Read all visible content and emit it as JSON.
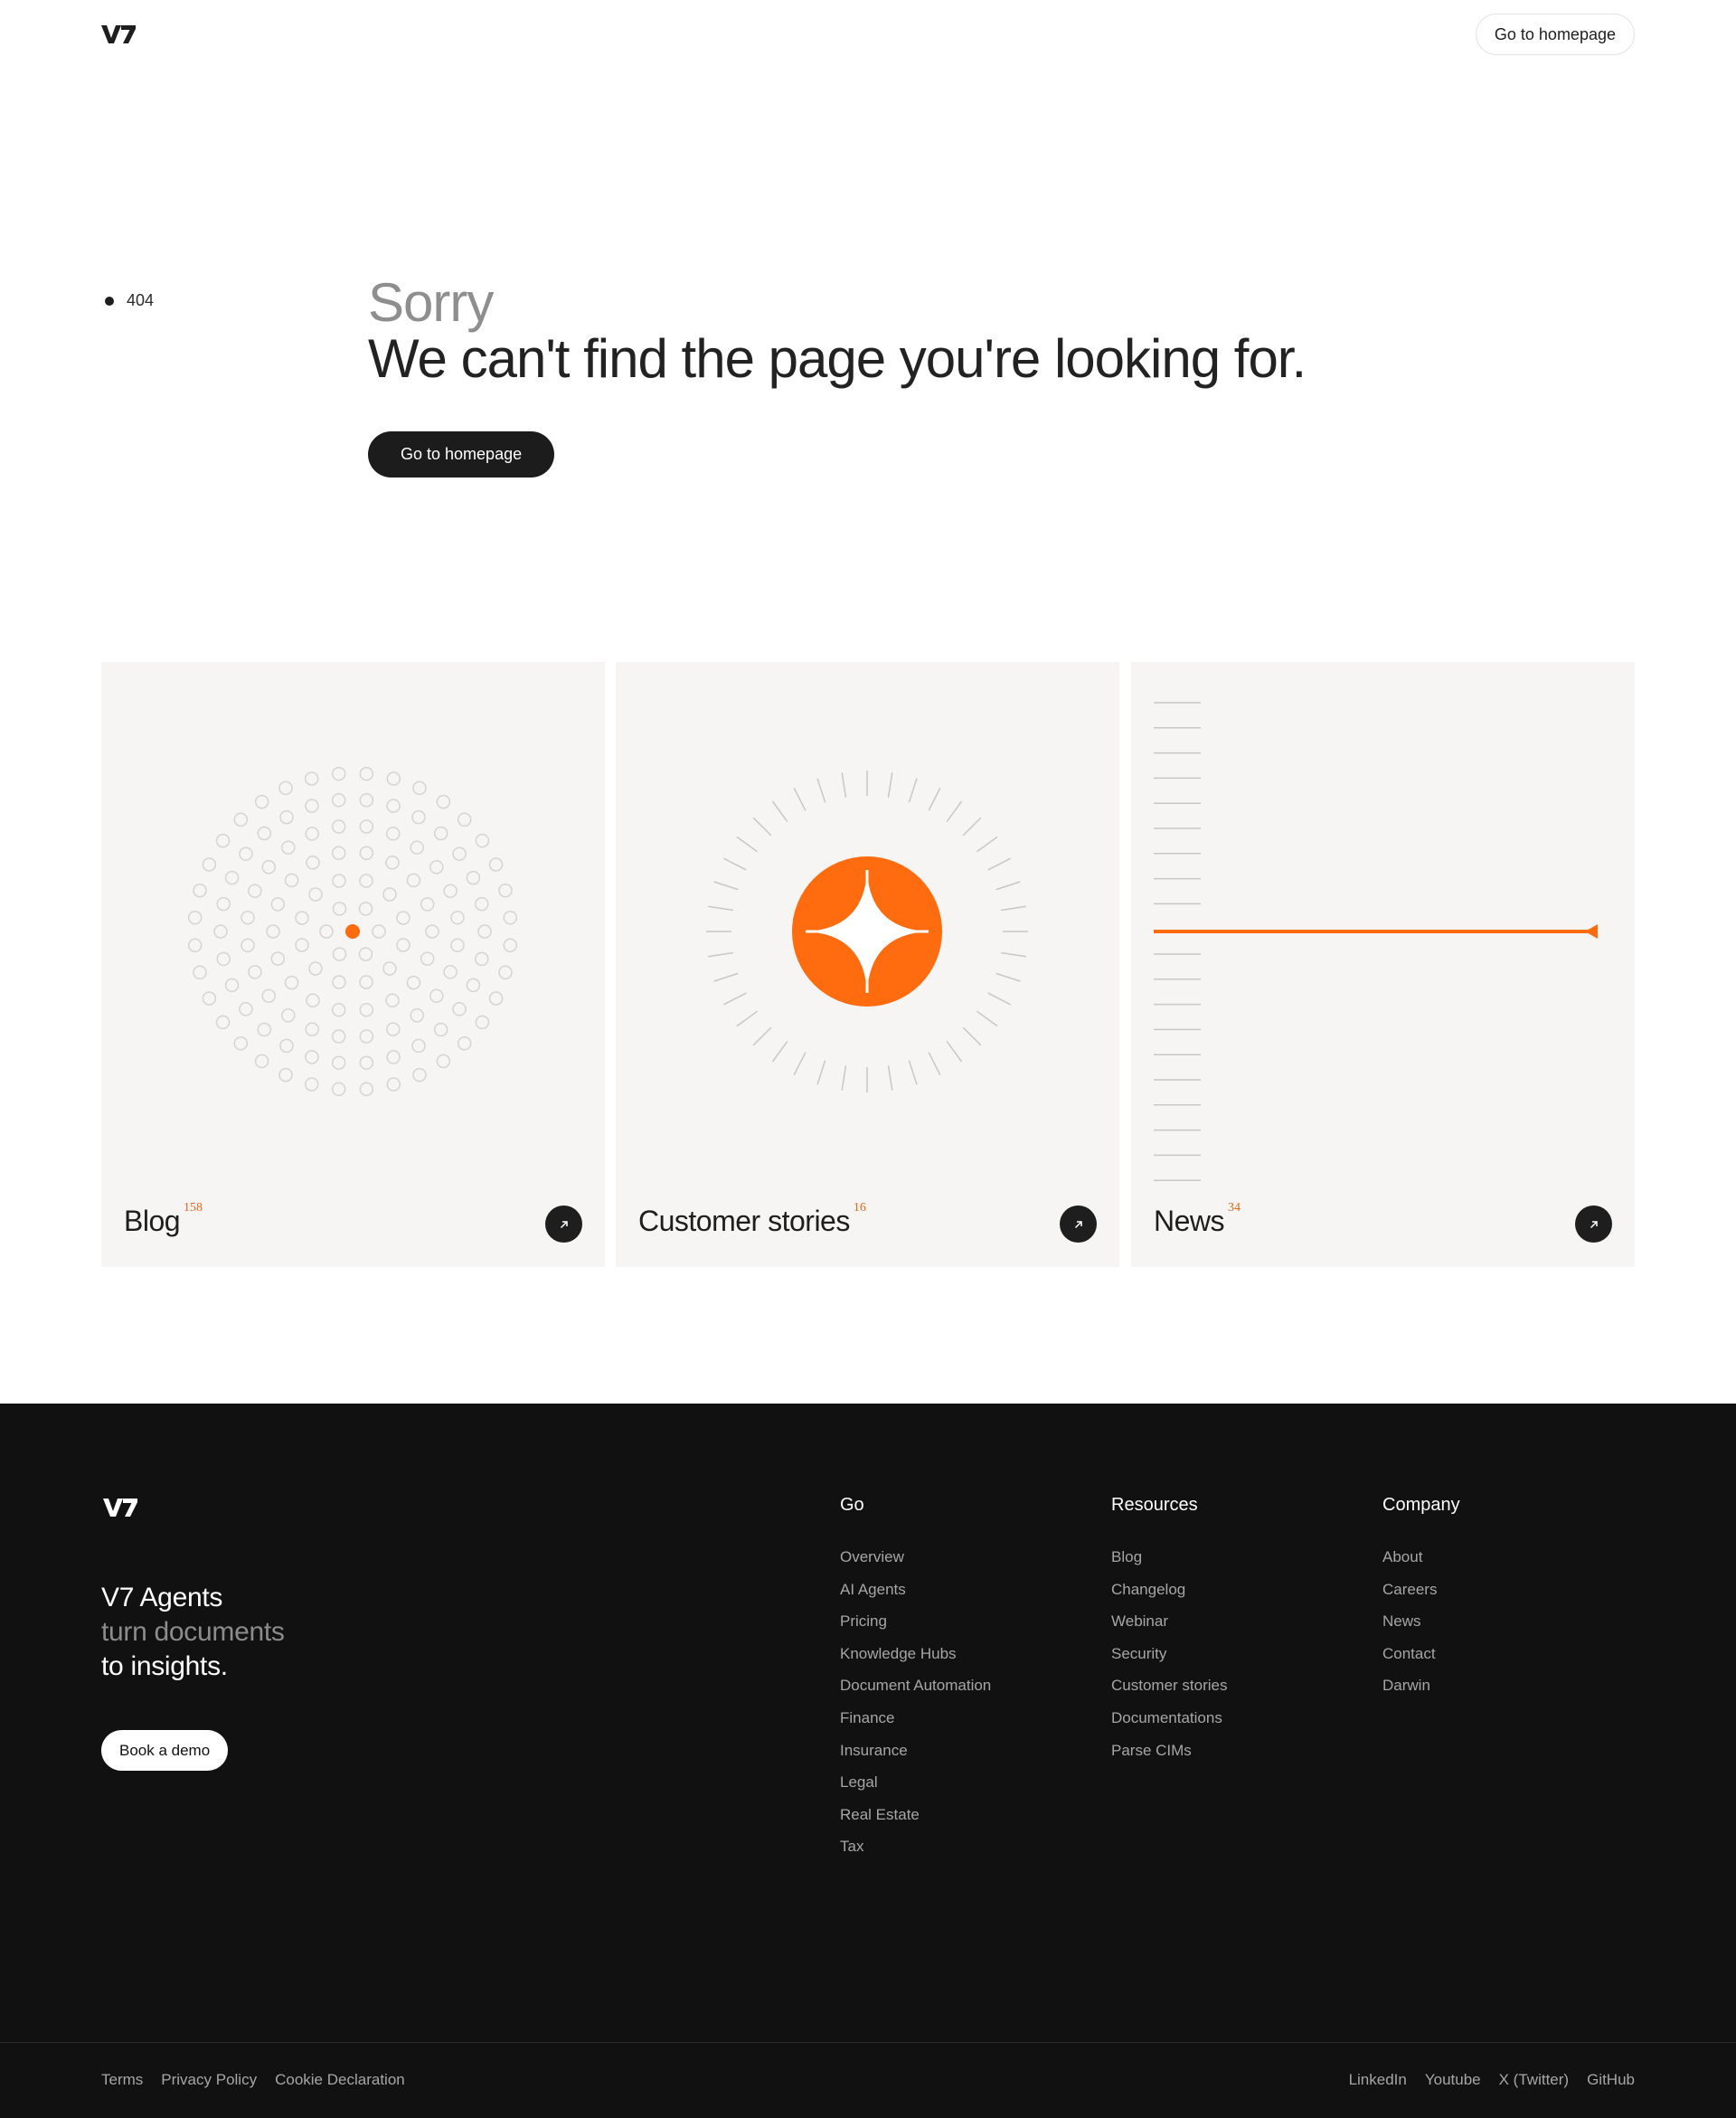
{
  "header": {
    "logo_text": "V7",
    "cta_label": "Go to homepage"
  },
  "hero": {
    "status_code": "404",
    "sorry": "Sorry",
    "message": "We can't find the page you're looking for.",
    "cta_label": "Go to homepage"
  },
  "cards": [
    {
      "label": "Blog",
      "count": "158",
      "icon": "arrow-up-right-icon"
    },
    {
      "label": "Customer stories",
      "count": "16",
      "icon": "arrow-up-right-icon"
    },
    {
      "label": "News",
      "count": "34",
      "icon": "arrow-up-right-icon"
    }
  ],
  "footer": {
    "logo_text": "V7",
    "tagline": {
      "line1": "V7 Agents",
      "line2": "turn documents",
      "line3": "to insights."
    },
    "demo_label": "Book a demo",
    "columns": [
      {
        "title": "Go",
        "links": [
          "Overview",
          "AI Agents",
          "Pricing",
          "Knowledge Hubs",
          "Document Automation",
          "Finance",
          "Insurance",
          "Legal",
          "Real Estate",
          "Tax"
        ]
      },
      {
        "title": "Resources",
        "links": [
          "Blog",
          "Changelog",
          "Webinar",
          "Security",
          "Customer stories",
          "Documentations",
          "Parse CIMs"
        ]
      },
      {
        "title": "Company",
        "links": [
          "About",
          "Careers",
          "News",
          "Contact",
          "Darwin"
        ]
      }
    ],
    "legal_links": [
      "Terms",
      "Privacy Policy",
      "Cookie Declaration"
    ],
    "social_links": [
      "LinkedIn",
      "Youtube",
      "X (Twitter)",
      "GitHub"
    ]
  },
  "colors": {
    "accent": "#ff6b0f",
    "card_bg": "#f6f5f3",
    "footer_bg": "#111111",
    "dark": "#1c1c1c"
  }
}
